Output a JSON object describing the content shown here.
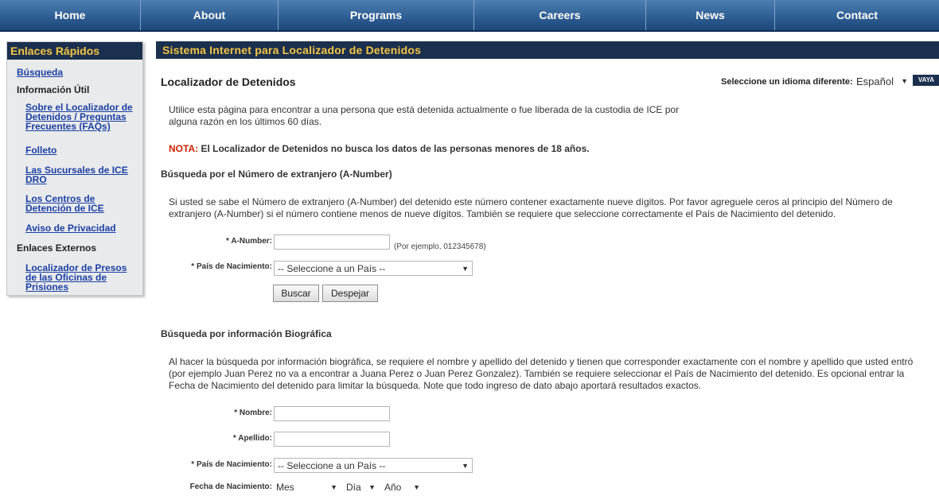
{
  "nav": {
    "items": [
      {
        "label": "Home"
      },
      {
        "label": "About"
      },
      {
        "label": "Programs"
      },
      {
        "label": "Careers"
      },
      {
        "label": "News"
      },
      {
        "label": "Contact"
      }
    ]
  },
  "sidebar": {
    "title": "Enlaces Rápidos",
    "search_link": "Búsqueda",
    "info_heading": "Información Útil",
    "info_links": [
      "Sobre el Localizador de Detenidos / Preguntas Frecuentes (FAQs)",
      "Folleto",
      "Las Sucursales de ICE DRO",
      "Los Centros de Detención de ICE",
      "Aviso de Privacidad"
    ],
    "external_heading": "Enlaces Externos",
    "external_links": [
      "Localizador de Presos de las Oficinas de Prisiones"
    ]
  },
  "main": {
    "header": "Sistema Internet para Localizador de Detenidos",
    "title": "Localizador de Detenidos",
    "language": {
      "label": "Seleccione un idioma diferente:",
      "selected": "Español",
      "go_label": "VAYA"
    },
    "intro": "Utilice esta página para encontrar a una persona que está detenida actualmente o fue liberada de la custodia de ICE por alguna razón en los últimos 60 días.",
    "note_prefix": "NOTA:",
    "note_text": " El Localizador de Detenidos no busca los datos de las personas menores de 18 años.",
    "anumber_section": {
      "title": "Búsqueda por el Número de extranjero (A-Number)",
      "description": "Si usted se sabe el Número de extranjero (A-Number) del detenido este número contener exactamente nueve dígitos. Por favor agreguele ceros al principio del Número de extranjero (A-Number) si el número contiene menos de nueve dígitos. También se requiere que seleccione correctamente el País de Nacimiento del detenido.",
      "anumber_label": "* A-Number:",
      "anumber_value": "",
      "anumber_example": "(Por ejemplo, 012345678)",
      "country_label": "* País de Nacimiento:",
      "country_selected": "-- Seleccione a un País --",
      "search_button": "Buscar",
      "clear_button": "Despejar"
    },
    "bio_section": {
      "title": "Búsqueda por información Biográfica",
      "description": "Al hacer la búsqueda por información biográfica, se requiere el nombre y apellido del detenido y tienen que corresponder exactamente con el nombre y apellido que usted entró (por ejemplo Juan Perez no va a encontrar a Juana Perez o Juan Perez Gonzalez). También se requiere seleccionar el País de Nacimiento del detenido. Es opcional entrar la Fecha de Nacimiento del detenido para limitar la búsqueda. Note que todo ingreso de dato abajo aportará resultados exactos.",
      "first_name_label": "* Nombre:",
      "first_name_value": "",
      "last_name_label": "* Apellido:",
      "last_name_value": "",
      "country_label": "* País de Nacimiento:",
      "country_selected": "-- Seleccione a un País --",
      "dob_label": "Fecha de Nacimiento:",
      "dob_month": "Mes",
      "dob_day": "Día",
      "dob_year": "Año"
    }
  },
  "colors": {
    "nav_blue": "#2f5f94",
    "header_navy": "#1b2f4f",
    "header_gold": "#f5c542",
    "link_blue": "#1a3fa3",
    "note_red": "#cc2200"
  }
}
